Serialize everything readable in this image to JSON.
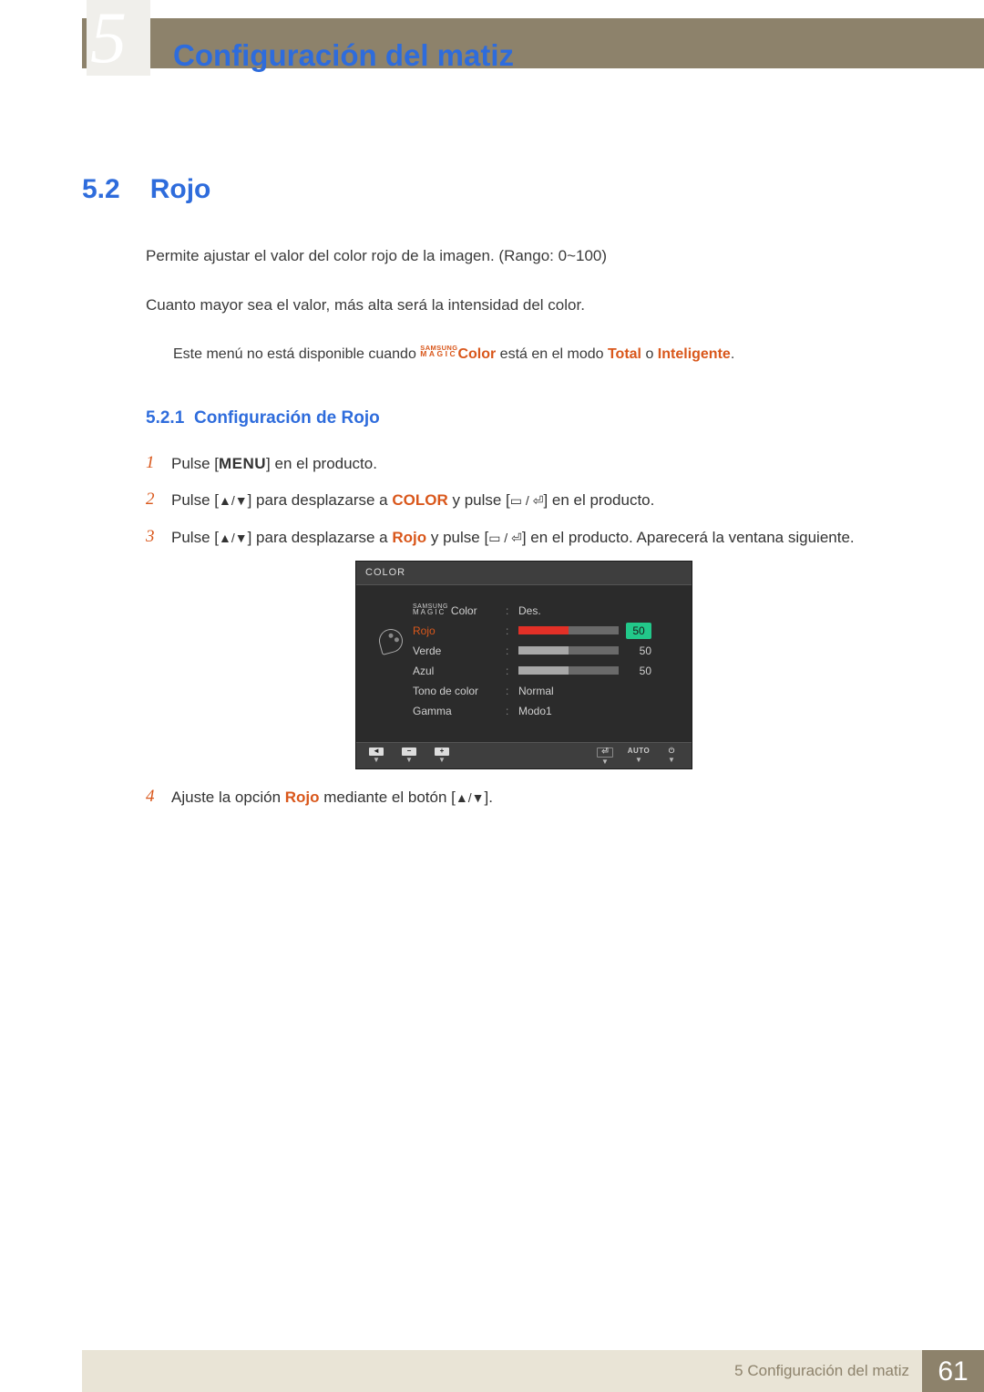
{
  "header": {
    "chapter_num_glyph": "5",
    "title": "Configuración del matiz"
  },
  "section": {
    "number": "5.2",
    "title": "Rojo",
    "para1": "Permite ajustar el valor del color rojo de la imagen. (Rango: 0~100)",
    "para2": "Cuanto mayor sea el valor, más alta será la intensidad del color.",
    "note_prefix": "Este menú no está disponible cuando ",
    "note_samsung_top": "SAMSUNG",
    "note_samsung_bot": "MAGIC",
    "note_color_word": "Color",
    "note_mid": " está en el modo ",
    "note_total": "Total",
    "note_or": " o ",
    "note_intel": "Inteligente",
    "note_end": "."
  },
  "subsection": {
    "number": "5.2.1",
    "title": "Configuración de Rojo"
  },
  "steps": {
    "s1_n": "1",
    "s1_a": "Pulse [",
    "s1_menu": "MENU",
    "s1_b": "] en el producto.",
    "s2_n": "2",
    "s2_a": "Pulse [",
    "s2_arrow": "▲/▼",
    "s2_b": "] para desplazarse a ",
    "s2_color": "COLOR",
    "s2_c": " y pulse [",
    "s2_enter": "▭ / ⏎",
    "s2_d": "] en el producto.",
    "s3_n": "3",
    "s3_a": "Pulse [",
    "s3_arrow": "▲/▼",
    "s3_b": "] para desplazarse a ",
    "s3_rojo": "Rojo",
    "s3_c": " y pulse [",
    "s3_enter": "▭ / ⏎",
    "s3_d": "] en el producto. Aparecerá la ventana siguiente.",
    "s4_n": "4",
    "s4_a": "Ajuste la opción ",
    "s4_rojo": "Rojo",
    "s4_b": " mediante el botón [",
    "s4_arrow": "▲/▼",
    "s4_c": "]."
  },
  "osd": {
    "title": "COLOR",
    "magic_top": "SAMSUNG",
    "magic_bot": "MAGIC",
    "magic_suffix": "Color",
    "magic_val": "Des.",
    "rojo_label": "Rojo",
    "rojo_val": "50",
    "verde_label": "Verde",
    "verde_val": "50",
    "azul_label": "Azul",
    "azul_val": "50",
    "tono_label": "Tono de color",
    "tono_val": "Normal",
    "gamma_label": "Gamma",
    "gamma_val": "Modo1",
    "foot_back": "◄",
    "foot_minus": "−",
    "foot_plus": "+",
    "foot_enter": "⏎",
    "foot_auto": "AUTO",
    "foot_power": "⏻",
    "foot_tri": "▼"
  },
  "chart_data": {
    "type": "bar",
    "title": "COLOR OSD sliders",
    "categories": [
      "Rojo",
      "Verde",
      "Azul"
    ],
    "values": [
      50,
      50,
      50
    ],
    "xlabel": "",
    "ylabel": "",
    "ylim": [
      0,
      100
    ]
  },
  "footer": {
    "text": "5 Configuración del matiz",
    "page": "61"
  }
}
